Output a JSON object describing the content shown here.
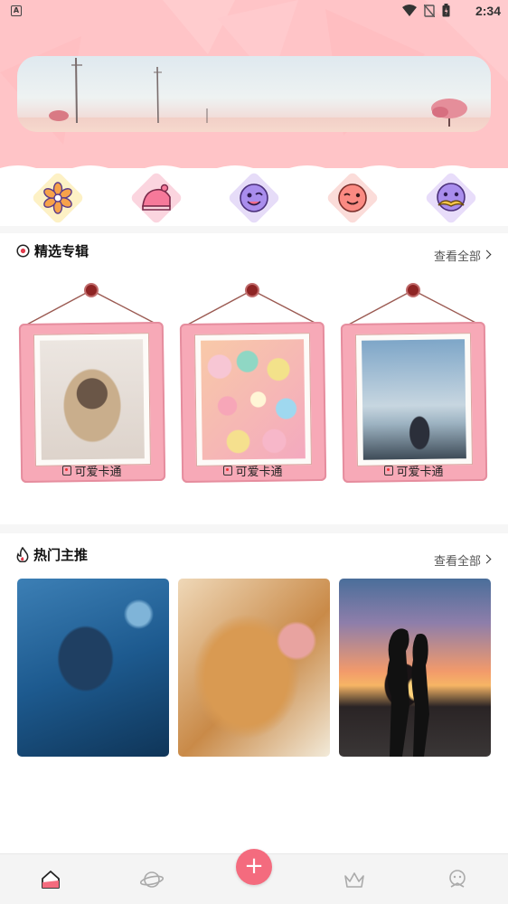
{
  "status_bar": {
    "time": "2:34",
    "notification_icon": "A"
  },
  "categories": [
    {
      "icon": "flower-icon",
      "bg": "#fdf1c5"
    },
    {
      "icon": "cake-icon",
      "bg": "#fbd5df"
    },
    {
      "icon": "wink-face-icon",
      "bg": "#e6dcf8"
    },
    {
      "icon": "smile-face-icon",
      "bg": "#fbdcd9"
    },
    {
      "icon": "mustache-face-icon",
      "bg": "#e8ddfa"
    }
  ],
  "featured": {
    "title": "精选专辑",
    "view_all": "查看全部",
    "albums": [
      {
        "label": "可爱卡通",
        "photo": "pug-dog"
      },
      {
        "label": "可爱卡通",
        "photo": "colorful-candies"
      },
      {
        "label": "可爱卡通",
        "photo": "boy-with-birds"
      }
    ]
  },
  "hot": {
    "title": "热门主推",
    "view_all": "查看全部",
    "items": [
      {
        "photo": "whale-shark"
      },
      {
        "photo": "sleeping-cat"
      },
      {
        "photo": "sunset-couple"
      }
    ]
  },
  "bottom_nav": {
    "items": [
      "home-icon",
      "planet-icon",
      "add-icon",
      "crown-icon",
      "profile-icon"
    ],
    "fab_label": "+",
    "active": "home-icon"
  },
  "colors": {
    "header": "#ffc4c7",
    "accent": "#f46b7e",
    "frame": "#f7a9b7"
  }
}
